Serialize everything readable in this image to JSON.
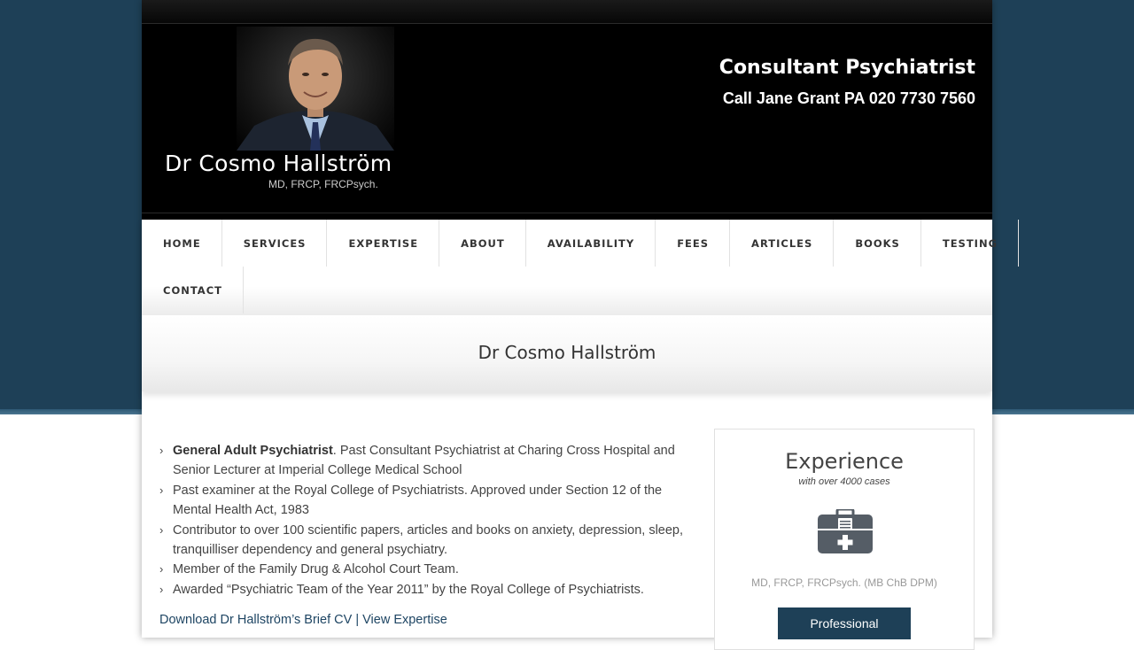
{
  "header": {
    "logo_name": "Dr Cosmo Hallström",
    "logo_quals": "MD, FRCP, FRCPsych.",
    "title": "Consultant Psychiatrist",
    "phone": "Call Jane Grant PA 020 7730 7560"
  },
  "nav": {
    "items": [
      "HOME",
      "SERVICES",
      "EXPERTISE",
      "ABOUT",
      "AVAILABILITY",
      "FEES",
      "ARTICLES",
      "BOOKS",
      "TESTING",
      "CONTACT"
    ]
  },
  "page_title": "Dr Cosmo Hallström",
  "content": {
    "bullets": [
      {
        "bold": "General Adult Psychiatrist",
        "text": ". Past Consultant Psychiatrist at Charing Cross Hospital and Senior Lecturer at Imperial College Medical School"
      },
      {
        "bold": "",
        "text": "Past examiner at the Royal College of Psychiatrists. Approved under Section 12 of the Mental Health Act, 1983"
      },
      {
        "bold": "",
        "text": "Contributor to over 100 scientific papers, articles and books on anxiety, depression, sleep, tranquilliser dependency and general psychiatry."
      },
      {
        "bold": "",
        "text": "Member of the Family Drug & Alcohol Court Team."
      },
      {
        "bold": "",
        "text": "Awarded “Psychiatric Team of the Year 2011” by the Royal College of Psychiatrists."
      }
    ],
    "link_cv": "Download Dr Hallström’s Brief CV",
    "link_sep": " | ",
    "link_expertise": "View Expertise"
  },
  "sidebar": {
    "title": "Experience",
    "subtitle": "with over 4000 cases",
    "icon": "medical-case-icon",
    "quals": "MD, FRCP, FRCPsych. (MB ChB DPM)",
    "button": "Professional"
  },
  "colors": {
    "background": "#1e4057",
    "header": "#000000",
    "button": "#1e4057",
    "link": "#1e4563"
  }
}
